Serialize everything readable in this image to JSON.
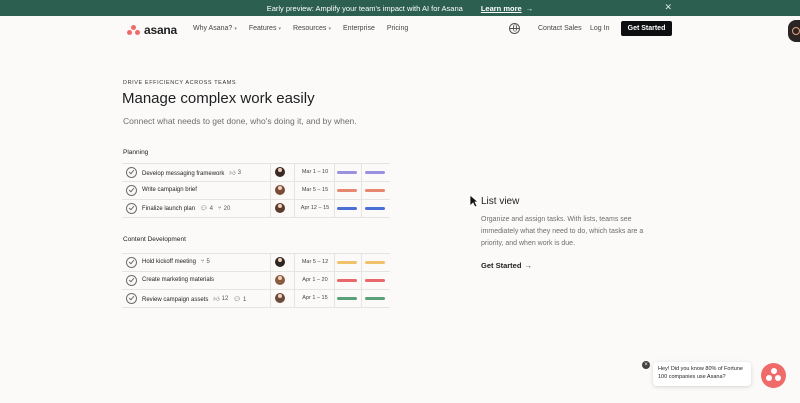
{
  "banner": {
    "text": "Early preview: Amplify your team's impact with AI for Asana",
    "link": "Learn more",
    "close_icon": "close-icon"
  },
  "nav": {
    "logo_text": "asana",
    "links": [
      {
        "label": "Why Asana?",
        "dropdown": true
      },
      {
        "label": "Features",
        "dropdown": true
      },
      {
        "label": "Resources",
        "dropdown": true
      },
      {
        "label": "Enterprise",
        "dropdown": false
      },
      {
        "label": "Pricing",
        "dropdown": false
      }
    ],
    "language_icon": "globe-icon",
    "contact_sales": "Contact Sales",
    "login": "Log In",
    "cta": "Get Started"
  },
  "hero": {
    "eyebrow": "DRIVE EFFICIENCY ACROSS TEAMS",
    "headline": "Manage complex work easily",
    "subhead": "Connect what needs to get done, who's doing it, and by when."
  },
  "sections": [
    {
      "title": "Planning",
      "tasks": [
        {
          "name": "Develop messaging framework",
          "likes": "3",
          "comments": "",
          "subtasks": "",
          "date": "Mar 1 – 10",
          "avatar_color": "#3b2a24",
          "color": "#9b8fe0"
        },
        {
          "name": "Write campaign brief",
          "likes": "",
          "comments": "",
          "subtasks": "",
          "date": "Mar 5 – 15",
          "avatar_color": "#7a4a3a",
          "color": "#e8876f"
        },
        {
          "name": "Finalize launch plan",
          "likes": "",
          "comments": "4",
          "subtasks": "20",
          "date": "Apr 12 – 15",
          "avatar_color": "#5a3b2c",
          "color": "#4c6fd6"
        }
      ]
    },
    {
      "title": "Content Development",
      "tasks": [
        {
          "name": "Hold kickoff meeting",
          "likes": "",
          "comments": "",
          "subtasks": "5",
          "date": "Mar 5 – 12",
          "avatar_color": "#2e2420",
          "color": "#f0c26a"
        },
        {
          "name": "Create marketing materials",
          "likes": "",
          "comments": "",
          "subtasks": "",
          "date": "Apr 1 – 20",
          "avatar_color": "#8a5a3e",
          "color": "#e8676a"
        },
        {
          "name": "Review campaign assets",
          "likes": "12",
          "comments": "1",
          "subtasks": "",
          "date": "Apr 1 – 15",
          "avatar_color": "#6b4a3a",
          "color": "#5aa07a"
        }
      ]
    }
  ],
  "right_panel": {
    "title": "List view",
    "body": "Organize and assign tasks. With lists, teams see immediately what they need to do, which tasks are a priority, and when work is due.",
    "link": "Get Started",
    "link_icon": "arrow-right-icon"
  },
  "chat": {
    "message": "Hey! Did you know 80% of Fortune 100 companies use Asana?",
    "close_icon": "close-icon",
    "launcher_icon": "asana-chat-icon"
  },
  "colors": {
    "banner_bg": "#2c5f4f",
    "brand": "#f06a6a",
    "cta_bg": "#0d0e10"
  }
}
